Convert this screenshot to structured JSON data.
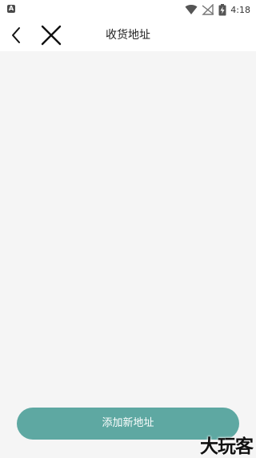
{
  "status_bar": {
    "app_icon_letter": "A",
    "time": "4:18",
    "icons": [
      "wifi-icon",
      "no-signal-icon",
      "battery-charging-icon"
    ]
  },
  "nav": {
    "title": "收货地址",
    "back_icon": "chevron-left-icon",
    "close_icon": "close-icon"
  },
  "content": {
    "add_button_label": "添加新地址"
  },
  "watermark": {
    "text": "大玩客"
  },
  "colors": {
    "accent": "#5ea8a2",
    "background": "#f5f5f5",
    "header": "#ffffff"
  }
}
